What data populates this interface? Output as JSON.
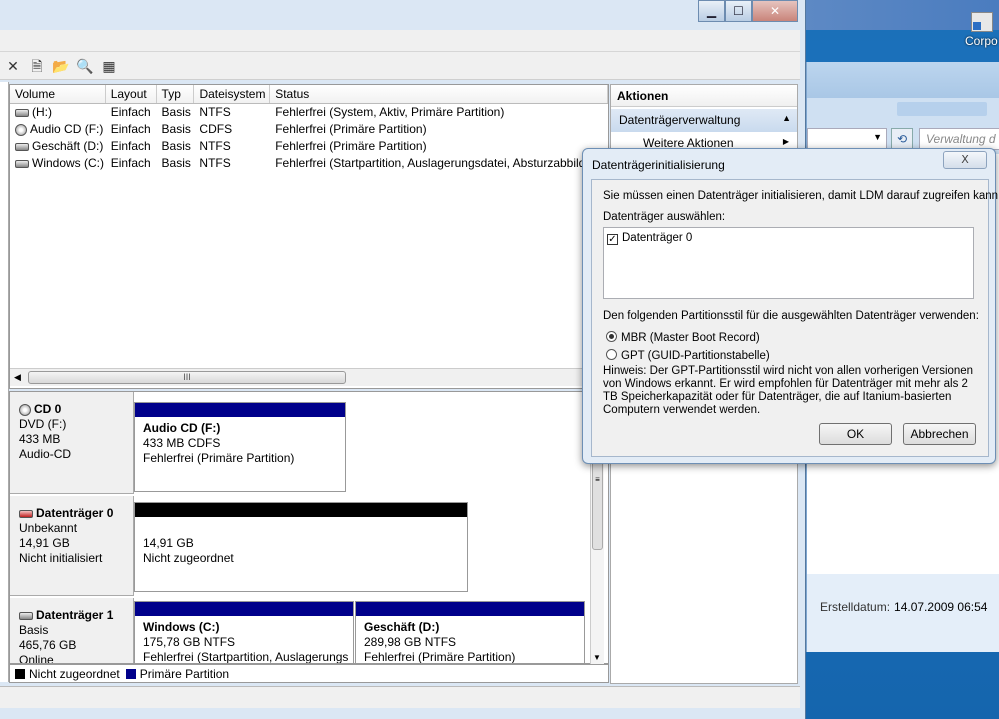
{
  "desktop": {
    "shortcut_label": "Corpo"
  },
  "window": {
    "min_glyph": "▁",
    "max_glyph": "☐",
    "close_glyph": "✕"
  },
  "toolbar": {
    "icons": [
      "delete-icon",
      "properties-icon",
      "open-folder-icon",
      "search-icon",
      "help-icon"
    ],
    "delete_glyph": "✕",
    "properties_glyph": "🗎",
    "open_glyph": "📂",
    "search_glyph": "🔍",
    "help_glyph": "▦"
  },
  "volumes": {
    "headers": [
      "Volume",
      "Layout",
      "Typ",
      "Dateisystem",
      "Status"
    ],
    "rows": [
      {
        "volume": "(H:)",
        "layout": "Einfach",
        "typ": "Basis",
        "fs": "NTFS",
        "status": "Fehlerfrei (System, Aktiv, Primäre Partition)"
      },
      {
        "volume": "Audio CD (F:)",
        "layout": "Einfach",
        "typ": "Basis",
        "fs": "CDFS",
        "status": "Fehlerfrei (Primäre Partition)"
      },
      {
        "volume": "Geschäft (D:)",
        "layout": "Einfach",
        "typ": "Basis",
        "fs": "NTFS",
        "status": "Fehlerfrei (Primäre Partition)"
      },
      {
        "volume": "Windows (C:)",
        "layout": "Einfach",
        "typ": "Basis",
        "fs": "NTFS",
        "status": "Fehlerfrei (Startpartition, Auslagerungsdatei, Absturzabbild"
      }
    ],
    "scroll_grip": "III"
  },
  "disks": [
    {
      "name": "CD 0",
      "l1": "DVD (F:)",
      "l2": "433 MB",
      "l3": "Audio-CD",
      "parts": [
        {
          "name": "Audio CD  (F:)",
          "size": "433 MB CDFS",
          "status": "Fehlerfrei (Primäre Partition)"
        }
      ]
    },
    {
      "name": "Datenträger 0",
      "l1": "Unbekannt",
      "l2": "14,91 GB",
      "l3": "Nicht initialisiert",
      "parts": [
        {
          "name": "",
          "size": "14,91 GB",
          "status": "Nicht zugeordnet"
        }
      ]
    },
    {
      "name": "Datenträger 1",
      "l1": "Basis",
      "l2": "465,76 GB",
      "l3": "Online",
      "parts": [
        {
          "name": "Windows  (C:)",
          "size": "175,78 GB NTFS",
          "status": "Fehlerfrei (Startpartition, Auslagerungs"
        },
        {
          "name": "Geschäft  (D:)",
          "size": "289,98 GB NTFS",
          "status": "Fehlerfrei (Primäre Partition)"
        }
      ]
    }
  ],
  "legend": {
    "unallocated": "Nicht zugeordnet",
    "primary": "Primäre Partition"
  },
  "colors": {
    "primary_bar": "#00008b",
    "unallocated_bar": "#000000"
  },
  "actions": {
    "heading": "Aktionen",
    "section": "Datenträgerverwaltung",
    "item": "Weitere Aktionen"
  },
  "bg_explorer": {
    "search_placeholder": "Verwaltung d",
    "created_label": "Erstelldatum:",
    "created_value": "14.07.2009 06:54"
  },
  "dialog": {
    "title": "Datenträgerinitialisierung",
    "close_glyph": "ⵝ",
    "intro": "Sie müssen einen Datenträger initialisieren, damit LDM darauf zugreifen kann.",
    "select_label": "Datenträger auswählen:",
    "disk_item": "Datenträger 0",
    "style_label": "Den folgenden Partitionsstil für die ausgewählten Datenträger verwenden:",
    "opt_mbr": "MBR (Master Boot Record)",
    "opt_gpt": "GPT (GUID-Partitionstabelle)",
    "hint": "Hinweis: Der GPT-Partitionsstil wird nicht von allen vorherigen Versionen von Windows erkannt. Er wird empfohlen für Datenträger mit mehr als 2 TB Speicherkapazität oder für Datenträger, die auf Itanium-basierten Computern verwendet werden.",
    "ok": "OK",
    "cancel": "Abbrechen"
  }
}
